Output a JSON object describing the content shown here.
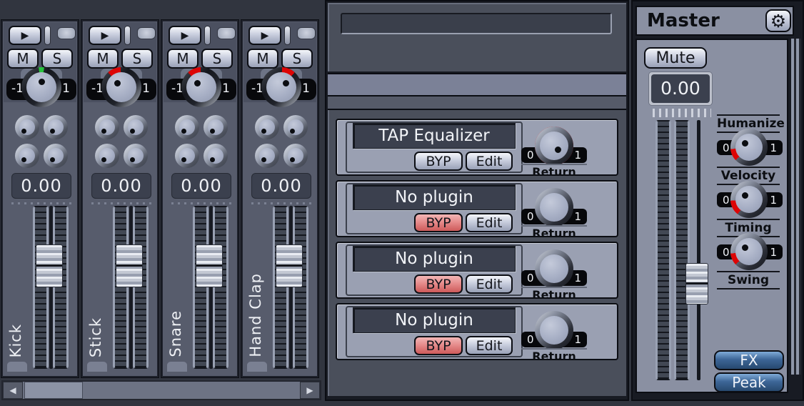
{
  "left_panel": {
    "channels": [
      {
        "name": "Kick",
        "volume": "0.00",
        "pan_indicator_color": "#27c23c"
      },
      {
        "name": "Stick",
        "volume": "0.00",
        "pan_indicator_color": "#dd0505"
      },
      {
        "name": "Snare",
        "volume": "0.00",
        "pan_indicator_color": "#dd0505"
      },
      {
        "name": "Hand Clap",
        "volume": "0.00",
        "pan_indicator_color": "#dd0505"
      }
    ],
    "strip_labels": {
      "mute": "M",
      "solo": "S",
      "pan_min": "-1",
      "pan_max": "1"
    }
  },
  "fx_rack": {
    "labels": {
      "bypass": "BYP",
      "edit": "Edit",
      "return": "Return",
      "knob_min": "0",
      "knob_max": "1"
    },
    "slots": [
      {
        "plugin_name": "TAP Equalizer",
        "bypass_active": false,
        "return_full": true
      },
      {
        "plugin_name": "No plugin",
        "bypass_active": true,
        "return_full": false
      },
      {
        "plugin_name": "No plugin",
        "bypass_active": true,
        "return_full": false
      },
      {
        "plugin_name": "No plugin",
        "bypass_active": true,
        "return_full": false
      }
    ]
  },
  "master": {
    "title": "Master",
    "mute_label": "Mute",
    "volume": "0.00",
    "humanize_header": "Humanize",
    "knob_scale": {
      "min": "0",
      "max": "1"
    },
    "knobs": [
      {
        "label": "Velocity"
      },
      {
        "label": "Timing"
      },
      {
        "label": "Swing"
      }
    ],
    "fx_label": "FX",
    "peak_label": "Peak"
  },
  "icons": {
    "play": "▶",
    "scroll_left": "◀",
    "scroll_right": "▶",
    "gear": "⚙"
  },
  "colors": {
    "accent_red": "#dd0505",
    "pan_center_green": "#27c23c",
    "button_blue": "#3d6697",
    "panel_light": "#8a90a2",
    "panel_mid": "#575c6c",
    "panel_dark": "#4a4f5b",
    "display_bg": "#3b404e"
  }
}
